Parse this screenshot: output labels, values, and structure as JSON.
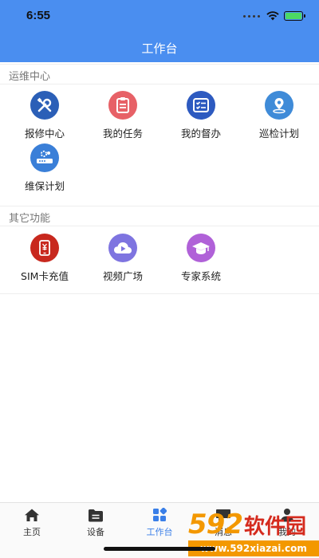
{
  "status_bar": {
    "time": "6:55"
  },
  "header": {
    "title": "工作台"
  },
  "sections": [
    {
      "title": "运维中心",
      "items": [
        {
          "label": "报修中心",
          "icon": "wrench-screwdriver-icon",
          "color": "#2b5fb7"
        },
        {
          "label": "我的任务",
          "icon": "clipboard-icon",
          "color": "#e76167"
        },
        {
          "label": "我的督办",
          "icon": "checklist-icon",
          "color": "#2d5ac0"
        },
        {
          "label": "巡检计划",
          "icon": "location-pin-icon",
          "color": "#3f8bd8"
        },
        {
          "label": "维保计划",
          "icon": "router-gear-icon",
          "color": "#3a7fd8"
        }
      ]
    },
    {
      "title": "其它功能",
      "items": [
        {
          "label": "SIM卡充值",
          "icon": "phone-yen-icon",
          "color": "#c8281e"
        },
        {
          "label": "视频广场",
          "icon": "cloud-play-icon",
          "color": "#7e74e0"
        },
        {
          "label": "专家系统",
          "icon": "graduation-cap-icon",
          "color": "#b061d8"
        }
      ]
    }
  ],
  "tabbar": {
    "tabs": [
      {
        "label": "主页",
        "icon": "home-icon",
        "active": false
      },
      {
        "label": "设备",
        "icon": "folder-icon",
        "active": false
      },
      {
        "label": "工作台",
        "icon": "grid-icon",
        "active": true
      },
      {
        "label": "消息",
        "icon": "message-icon",
        "active": false
      },
      {
        "label": "我的",
        "icon": "user-icon",
        "active": false
      }
    ]
  },
  "watermark": {
    "number": "592",
    "text": "软件园",
    "url": "www.592xiazai.com"
  },
  "colors": {
    "primary": "#4a8ef0",
    "active_tab": "#3a7fe8"
  }
}
